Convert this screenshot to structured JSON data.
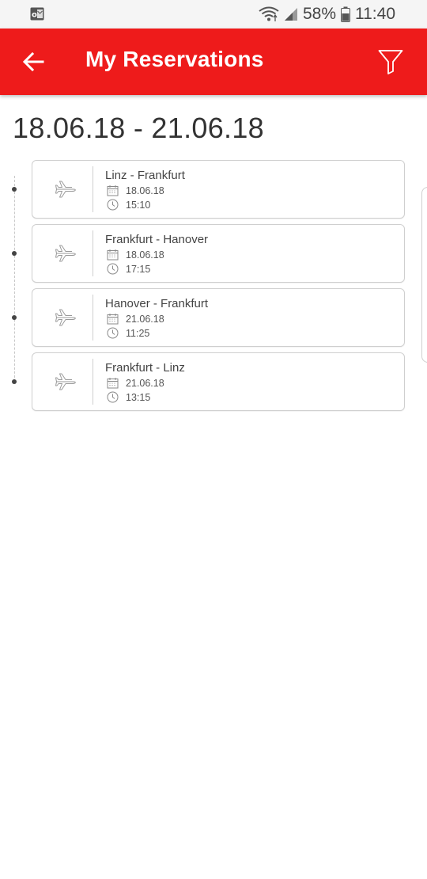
{
  "status_bar": {
    "notification_icon": "outlook-icon",
    "battery_percent": "58%",
    "time": "11:40"
  },
  "app_bar": {
    "title": "My Reservations",
    "back_icon": "arrow-left-icon",
    "filter_icon": "filter-icon",
    "color": "#ee1b1b"
  },
  "date_range": "18.06.18 - 21.06.18",
  "reservations": [
    {
      "route": "Linz - Frankfurt",
      "date": "18.06.18",
      "time": "15:10",
      "icon": "airplane-icon"
    },
    {
      "route": "Frankfurt - Hanover",
      "date": "18.06.18",
      "time": "17:15",
      "icon": "airplane-icon"
    },
    {
      "route": "Hanover - Frankfurt",
      "date": "21.06.18",
      "time": "11:25",
      "icon": "airplane-icon"
    },
    {
      "route": "Frankfurt - Linz",
      "date": "21.06.18",
      "time": "13:15",
      "icon": "airplane-icon"
    }
  ]
}
